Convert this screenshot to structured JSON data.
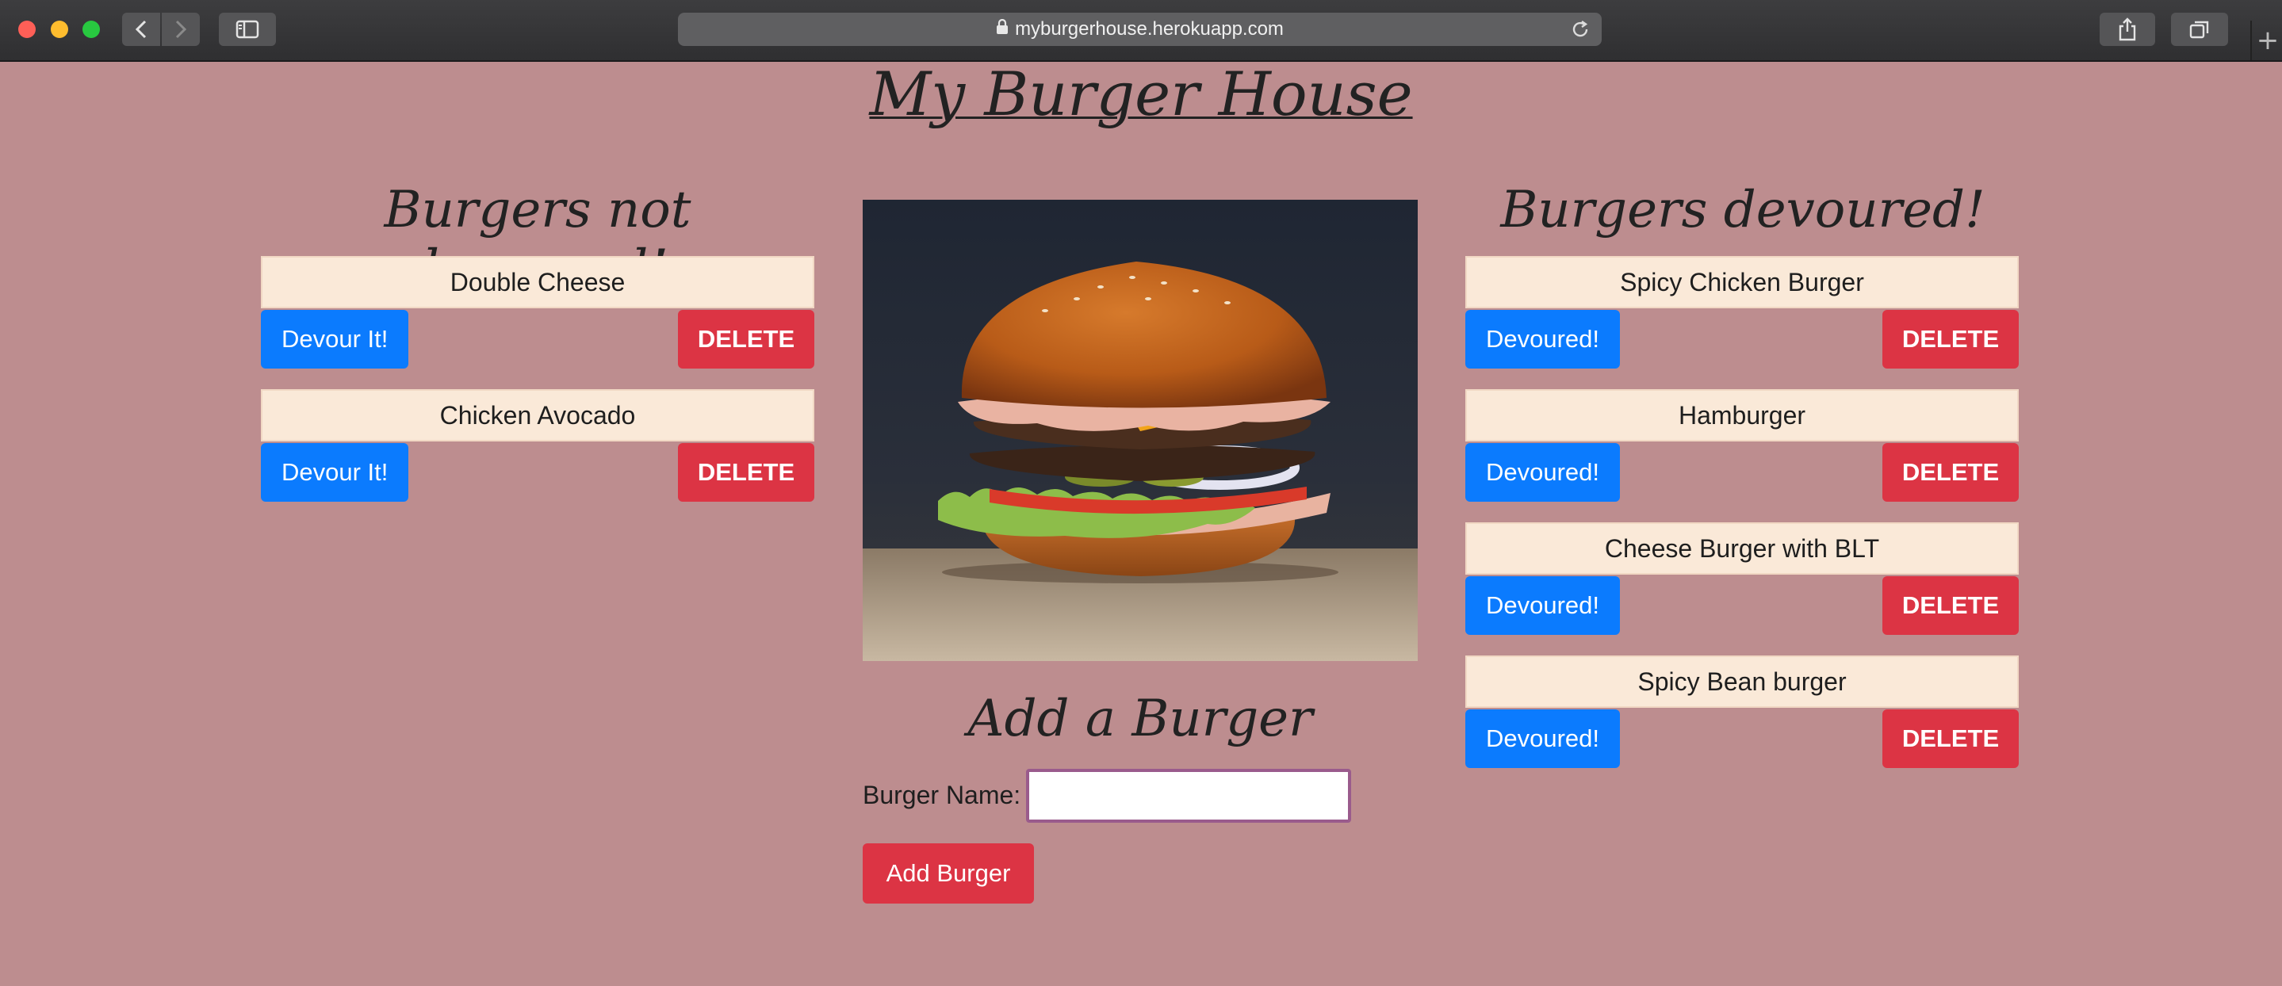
{
  "browser": {
    "url": "myburgerhouse.herokuapp.com"
  },
  "page": {
    "title": "My Burger House"
  },
  "not_devoured": {
    "heading": "Burgers not devoured!",
    "devour_label": "Devour It!",
    "delete_label": "DELETE",
    "items": [
      {
        "name": "Double Cheese"
      },
      {
        "name": "Chicken Avocado"
      }
    ]
  },
  "devoured": {
    "heading": "Burgers devoured!",
    "devoured_label": "Devoured!",
    "delete_label": "DELETE",
    "items": [
      {
        "name": "Spicy Chicken Burger"
      },
      {
        "name": "Hamburger"
      },
      {
        "name": "Cheese Burger with BLT"
      },
      {
        "name": "Spicy Bean burger"
      }
    ]
  },
  "add_form": {
    "heading": "Add a Burger",
    "label": "Burger Name:",
    "value": "",
    "button_label": "Add Burger"
  },
  "colors": {
    "background": "#bd8d8f",
    "card": "#fae9d8",
    "primary": "#0b7bfe",
    "danger": "#dc3444"
  }
}
